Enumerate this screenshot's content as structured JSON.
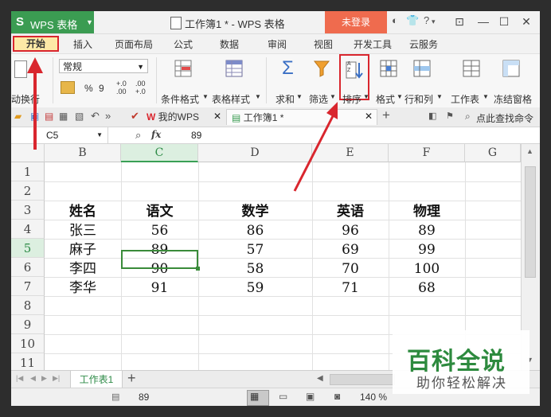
{
  "app": {
    "logo_s": "S",
    "logo_text": "WPS 表格",
    "doc_title": "工作簿1 * - WPS 表格",
    "login": "未登录",
    "help": "?"
  },
  "menu": {
    "home": "开始",
    "insert": "插入",
    "layout": "页面布局",
    "formula": "公式",
    "data": "数据",
    "review": "审阅",
    "view": "视图",
    "dev": "开发工具",
    "cloud": "云服务"
  },
  "ribbon": {
    "wrap": "动换行",
    "number_format": "常规",
    "percent": "%",
    "comma": "9",
    "dec_inc": "+.0 .00",
    "dec_dec": ".00 +.0",
    "cond_format": "条件格式",
    "table_style": "表格样式",
    "sum": "求和",
    "filter": "筛选",
    "sort": "排序",
    "format": "格式",
    "rows_cols": "行和列",
    "worksheet": "工作表",
    "freeze": "冻结窗格",
    "sigma": "Σ",
    "sort_az": "A Z"
  },
  "doctabs": {
    "mywps": "我的WPS",
    "workbook": "工作簿1 *",
    "add": "+",
    "search": "点此查找命令"
  },
  "formula_bar": {
    "cell_ref": "C5",
    "fx": "fx",
    "value": "89"
  },
  "grid": {
    "columns": [
      "B",
      "C",
      "D",
      "E",
      "F",
      "G"
    ],
    "rows": [
      "1",
      "2",
      "3",
      "4",
      "5",
      "6",
      "7",
      "8",
      "9",
      "10",
      "11"
    ],
    "headers": [
      "姓名",
      "语文",
      "数学",
      "英语",
      "物理"
    ],
    "data": [
      [
        "张三",
        "56",
        "86",
        "96",
        "89"
      ],
      [
        "麻子",
        "89",
        "57",
        "69",
        "99"
      ],
      [
        "李四",
        "90",
        "58",
        "70",
        "100"
      ],
      [
        "李华",
        "91",
        "59",
        "71",
        "68"
      ]
    ]
  },
  "sheets": {
    "active": "工作表1",
    "add": "+"
  },
  "status": {
    "value": "89",
    "zoom": "140 %"
  },
  "watermark": {
    "title": "百科全说",
    "subtitle": "助你轻松解决"
  },
  "colors": {
    "brand_green": "#3b9c52",
    "login_orange": "#ef6b4e",
    "annotation_red": "#d9262e",
    "selection_green": "#3a8b3a"
  }
}
